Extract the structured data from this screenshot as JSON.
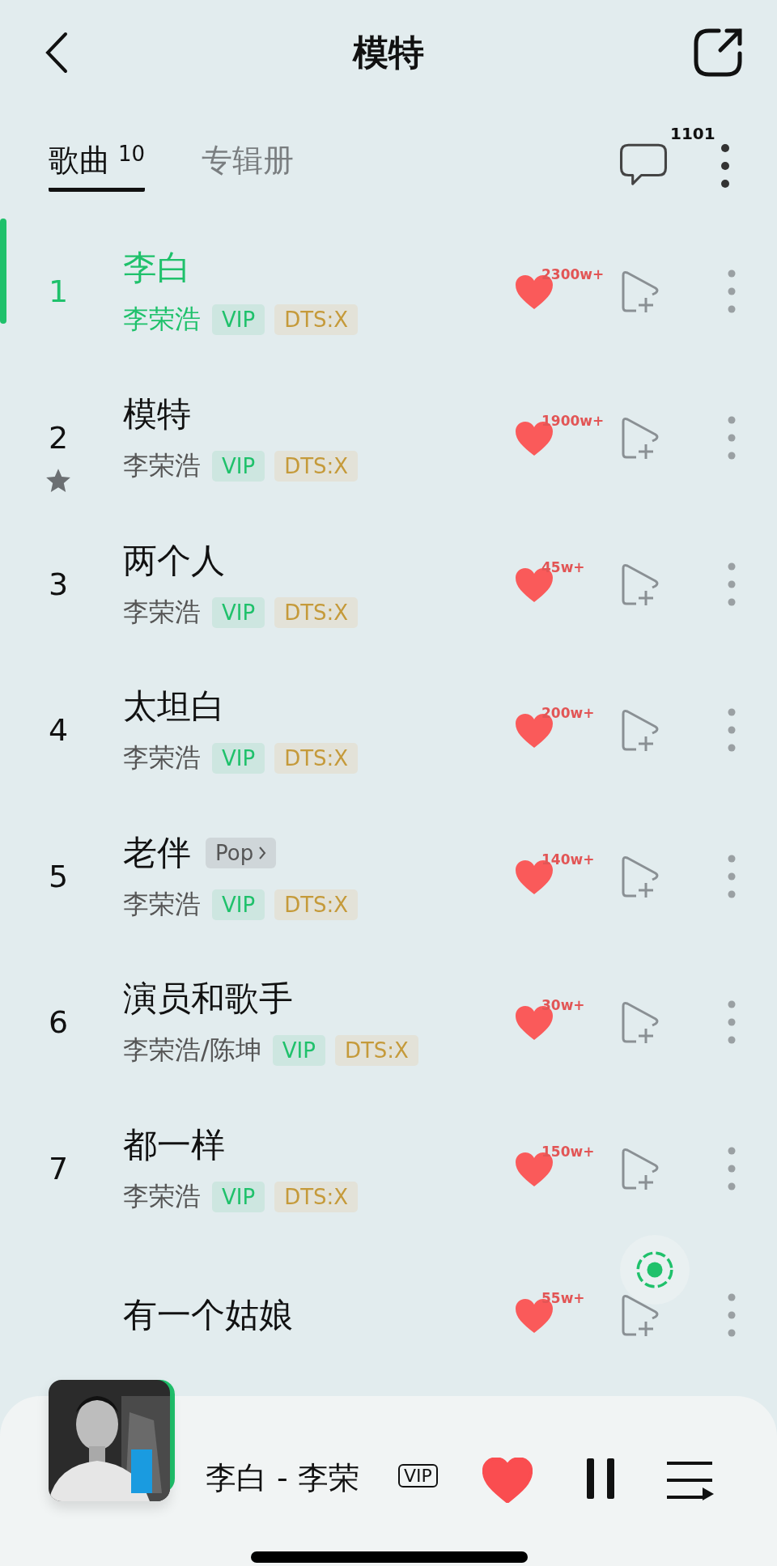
{
  "header": {
    "title": "模特"
  },
  "tabs": [
    {
      "label": "歌曲",
      "count": "10",
      "selected": true
    },
    {
      "label": "专辑册",
      "selected": false
    }
  ],
  "comments": {
    "count": "1101"
  },
  "songs": [
    {
      "number": "1",
      "title": "李白",
      "artist": "李荣浩",
      "tags": [
        "VIP",
        "DTS:X"
      ],
      "likes": "2300w+",
      "selected": true,
      "starred": false
    },
    {
      "number": "2",
      "title": "模特",
      "artist": "李荣浩",
      "tags": [
        "VIP",
        "DTS:X"
      ],
      "likes": "1900w+",
      "selected": false,
      "starred": true
    },
    {
      "number": "3",
      "title": "两个人",
      "artist": "李荣浩",
      "tags": [
        "VIP",
        "DTS:X"
      ],
      "likes": "45w+",
      "selected": false,
      "starred": false
    },
    {
      "number": "4",
      "title": "太坦白",
      "artist": "李荣浩",
      "tags": [
        "VIP",
        "DTS:X"
      ],
      "likes": "200w+",
      "selected": false,
      "starred": false
    },
    {
      "number": "5",
      "title": "老伴",
      "genre": "Pop",
      "artist": "李荣浩",
      "tags": [
        "VIP",
        "DTS:X"
      ],
      "likes": "140w+",
      "selected": false,
      "starred": false
    },
    {
      "number": "6",
      "title": "演员和歌手",
      "artist": "李荣浩/陈坤",
      "tags": [
        "VIP",
        "DTS:X"
      ],
      "likes": "30w+",
      "selected": false,
      "starred": false
    },
    {
      "number": "7",
      "title": "都一样",
      "artist": "李荣浩",
      "tags": [
        "VIP",
        "DTS:X"
      ],
      "likes": "150w+",
      "selected": false,
      "starred": false
    },
    {
      "title": "有一个姑娘",
      "likes": "55w+",
      "selected": false,
      "starred": false
    }
  ],
  "player": {
    "now_playing": "李白 - 李荣",
    "badge": "VIP",
    "liked": true
  }
}
